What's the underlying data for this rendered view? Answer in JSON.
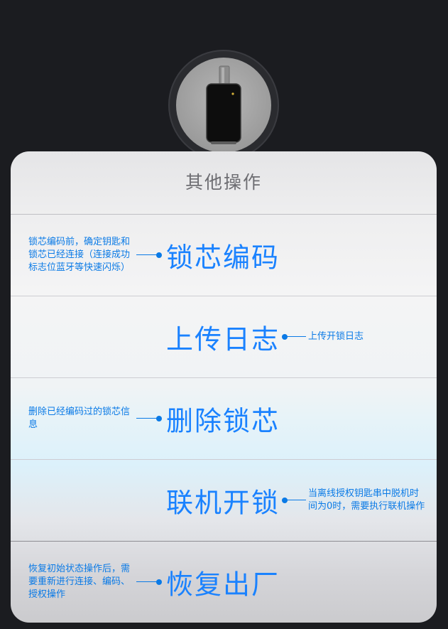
{
  "device": {
    "icon": "key-device-icon"
  },
  "sheet": {
    "title": "其他操作",
    "rows": [
      {
        "action": "锁芯编码",
        "note": "锁芯编码前，确定钥匙和锁芯已经连接（连接成功标志位蓝牙等快速闪烁）",
        "note_side": "left"
      },
      {
        "action": "上传日志",
        "note": "上传开锁日志",
        "note_side": "right"
      },
      {
        "action": "删除锁芯",
        "note": "删除已经编码过的锁芯信息",
        "note_side": "left"
      },
      {
        "action": "联机开锁",
        "note": "当离线授权钥匙串中脱机时间为0时，需要执行联机操作",
        "note_side": "right"
      },
      {
        "action": "恢复出厂",
        "note": "恢复初始状态操作后，需要重新进行连接、编码、授权操作",
        "note_side": "left"
      }
    ]
  },
  "colors": {
    "accent": "#1a82ff",
    "annotation": "#0a7ae6",
    "background": "#1b1c20"
  }
}
